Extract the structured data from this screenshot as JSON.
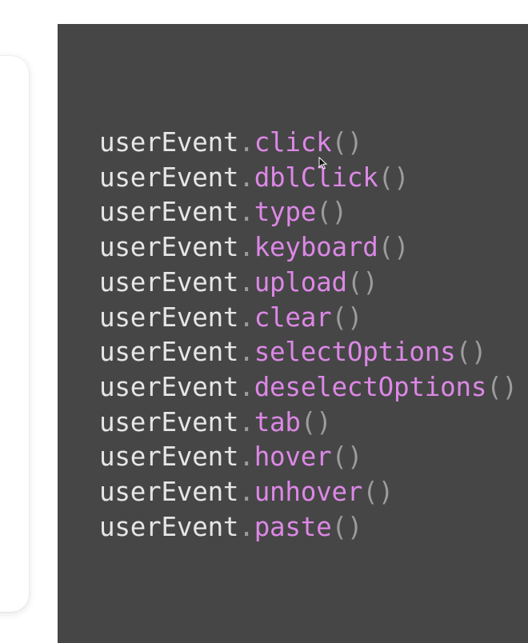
{
  "code": {
    "object": "userEvent",
    "dot": ".",
    "parens": "()",
    "methods": [
      "click",
      "dblClick",
      "type",
      "keyboard",
      "upload",
      "clear",
      "selectOptions",
      "deselectOptions",
      "tab",
      "hover",
      "unhover",
      "paste"
    ]
  },
  "colors": {
    "panel_background": "#464646",
    "object_text": "#e6e6e6",
    "method_text": "#dc88e6",
    "punctuation": "#9c9c9c"
  },
  "icons": {
    "cursor": "mouse-pointer-icon"
  }
}
